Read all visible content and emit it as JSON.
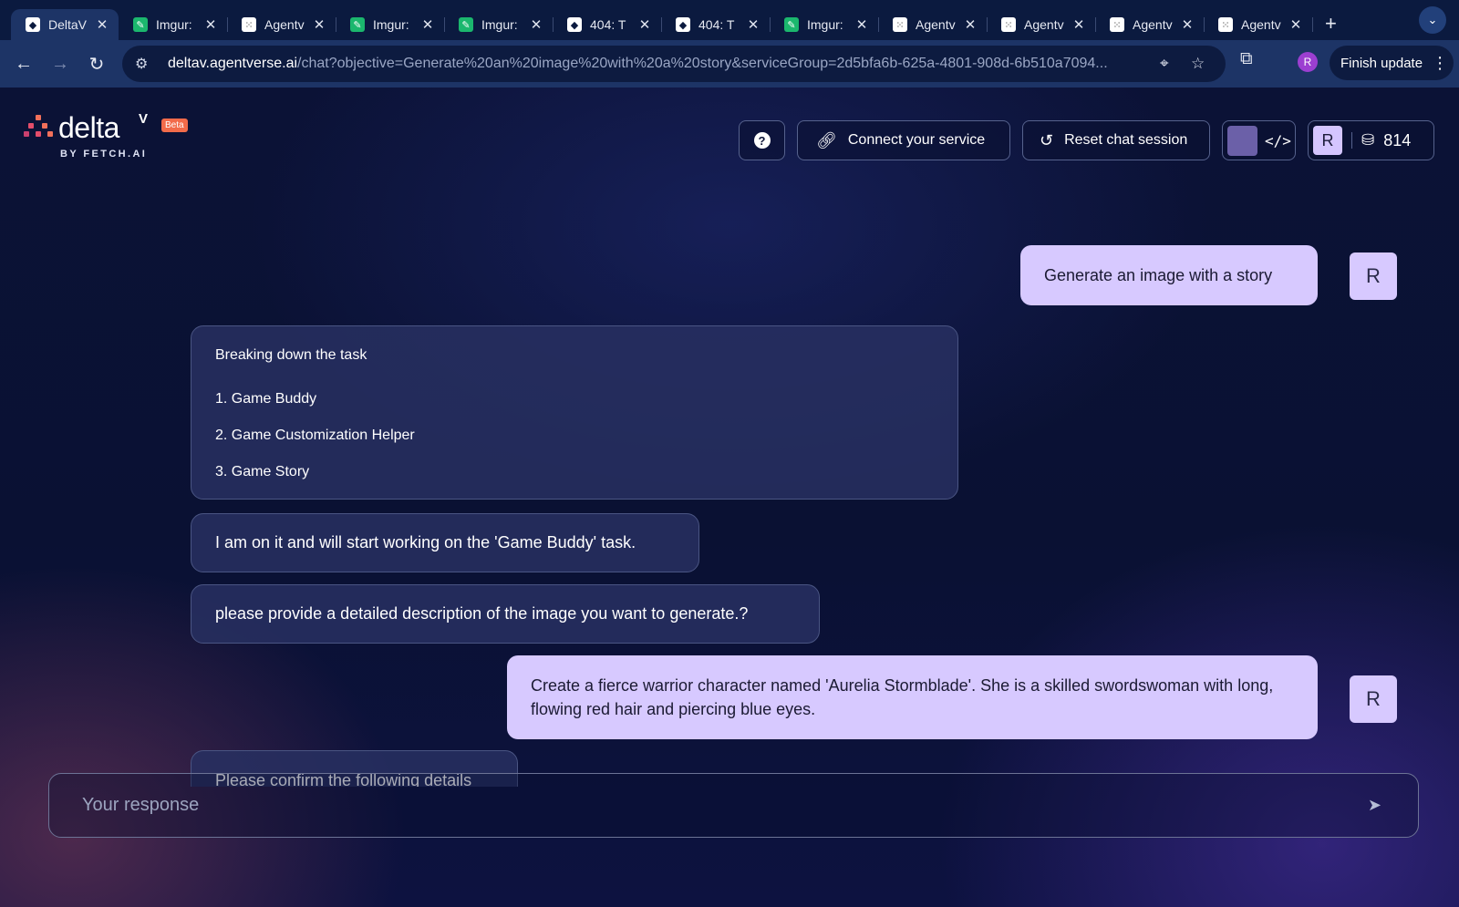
{
  "browser": {
    "tabs": [
      {
        "title": "DeltaV",
        "icon": "deltav-favicon",
        "active": true
      },
      {
        "title": "Imgur:",
        "icon": "imgur-favicon"
      },
      {
        "title": "Agentv",
        "icon": "agentverse-favicon"
      },
      {
        "title": "Imgur:",
        "icon": "imgur-favicon"
      },
      {
        "title": "Imgur:",
        "icon": "imgur-favicon"
      },
      {
        "title": "404: T",
        "icon": "deltav-favicon"
      },
      {
        "title": "404: T",
        "icon": "deltav-favicon"
      },
      {
        "title": "Imgur:",
        "icon": "imgur-favicon"
      },
      {
        "title": "Agentv",
        "icon": "agentverse-favicon"
      },
      {
        "title": "Agentv",
        "icon": "agentverse-favicon"
      },
      {
        "title": "Agentv",
        "icon": "agentverse-favicon"
      },
      {
        "title": "Agentv",
        "icon": "agentverse-favicon"
      }
    ],
    "url_host": "deltav.agentverse.ai",
    "url_path": "/chat?objective=Generate%20an%20image%20with%20a%20story&serviceGroup=2d5bfa6b-625a-4801-908d-6b510a7094...",
    "profile_initial": "R",
    "finish_update_label": "Finish update"
  },
  "header": {
    "logo_text": "delta",
    "logo_sup": "V",
    "beta_label": "Beta",
    "byline": "BY FETCH.AI",
    "help_label": "?",
    "connect_label": "Connect your service",
    "reset_label": "Reset chat session",
    "code_label": "</>",
    "user_initial": "R",
    "credits": "814"
  },
  "chat": {
    "user_message_1": "Generate an image with a story",
    "task_heading": "Breaking down the task",
    "tasks": [
      "1. Game Buddy",
      "2. Game Customization Helper",
      "3. Game Story"
    ],
    "agent_message_1": "I am on it and will start working on the 'Game Buddy' task.",
    "agent_message_2": "please provide a detailed description of the image you want to generate.?",
    "user_message_2": "Create a fierce warrior character named 'Aurelia Stormblade'. She is a skilled swordswoman with long, flowing red hair and piercing blue eyes.",
    "agent_message_3": "Please confirm the following details",
    "user_avatar_initial": "R"
  },
  "composer": {
    "placeholder": "Your response"
  },
  "colors": {
    "user_bubble": "#d7c9ff",
    "agent_bubble": "#28306280",
    "beta_badge": "#f26b4a",
    "page_bg": "#0a1133"
  }
}
